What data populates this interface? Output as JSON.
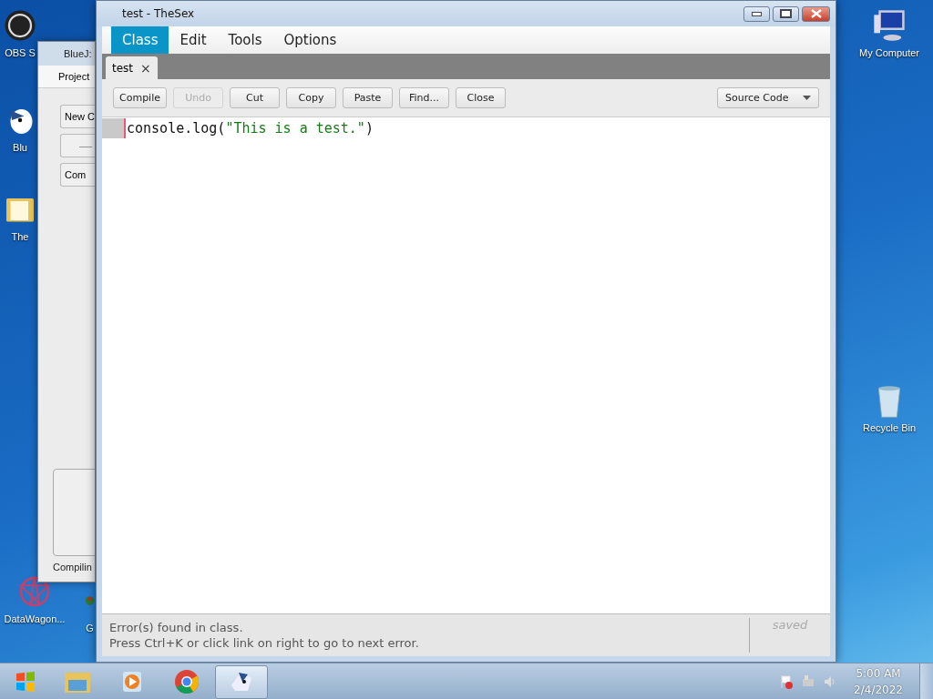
{
  "desktop_icons": [
    {
      "label": "OBS S",
      "kind": "obs"
    },
    {
      "label": "Blu",
      "kind": "bird"
    },
    {
      "label": "The",
      "kind": "folder"
    },
    {
      "label": "DataWagon...",
      "kind": "star"
    },
    {
      "label": "G",
      "kind": "app"
    },
    {
      "label": "My Computer",
      "kind": "computer"
    },
    {
      "label": "Recycle Bin",
      "kind": "bin"
    }
  ],
  "back_window": {
    "title": "BlueJ:",
    "menu": "Project",
    "buttons": [
      {
        "kind": "text",
        "label": "New C"
      },
      {
        "kind": "dash"
      },
      {
        "kind": "text",
        "label": "Com"
      }
    ],
    "status": "Compilin"
  },
  "window": {
    "title": "test - TheSex",
    "menus": [
      {
        "label": "Class",
        "selected": true
      },
      {
        "label": "Edit",
        "selected": false
      },
      {
        "label": "Tools",
        "selected": false
      },
      {
        "label": "Options",
        "selected": false
      }
    ],
    "tabs": [
      {
        "label": "test",
        "close": "×",
        "selected": true
      }
    ],
    "toolbar": [
      {
        "label": "Compile",
        "disabled": false
      },
      {
        "label": "Undo",
        "disabled": true
      },
      {
        "label": "Cut",
        "disabled": false
      },
      {
        "label": "Copy",
        "disabled": false
      },
      {
        "label": "Paste",
        "disabled": false
      },
      {
        "label": "Find...",
        "disabled": false
      },
      {
        "label": "Close",
        "disabled": false
      }
    ],
    "view_select": "Source Code",
    "code_lines": [
      {
        "tokens": [
          {
            "text": "console.log(",
            "kind": "plain"
          },
          {
            "text": "\"This is a test.\"",
            "kind": "string"
          },
          {
            "text": ")",
            "kind": "plain"
          }
        ]
      }
    ],
    "status": [
      "Error(s) found in class.",
      "Press Ctrl+K or click link on right to go to next error."
    ],
    "saved": "saved"
  },
  "taskbar": {
    "apps": [
      {
        "kind": "folder",
        "selected": false
      },
      {
        "kind": "media",
        "selected": false
      },
      {
        "kind": "chrome",
        "selected": false
      },
      {
        "kind": "bird",
        "selected": true
      }
    ],
    "time": "5:00 AM",
    "date": "2/4/2022"
  }
}
